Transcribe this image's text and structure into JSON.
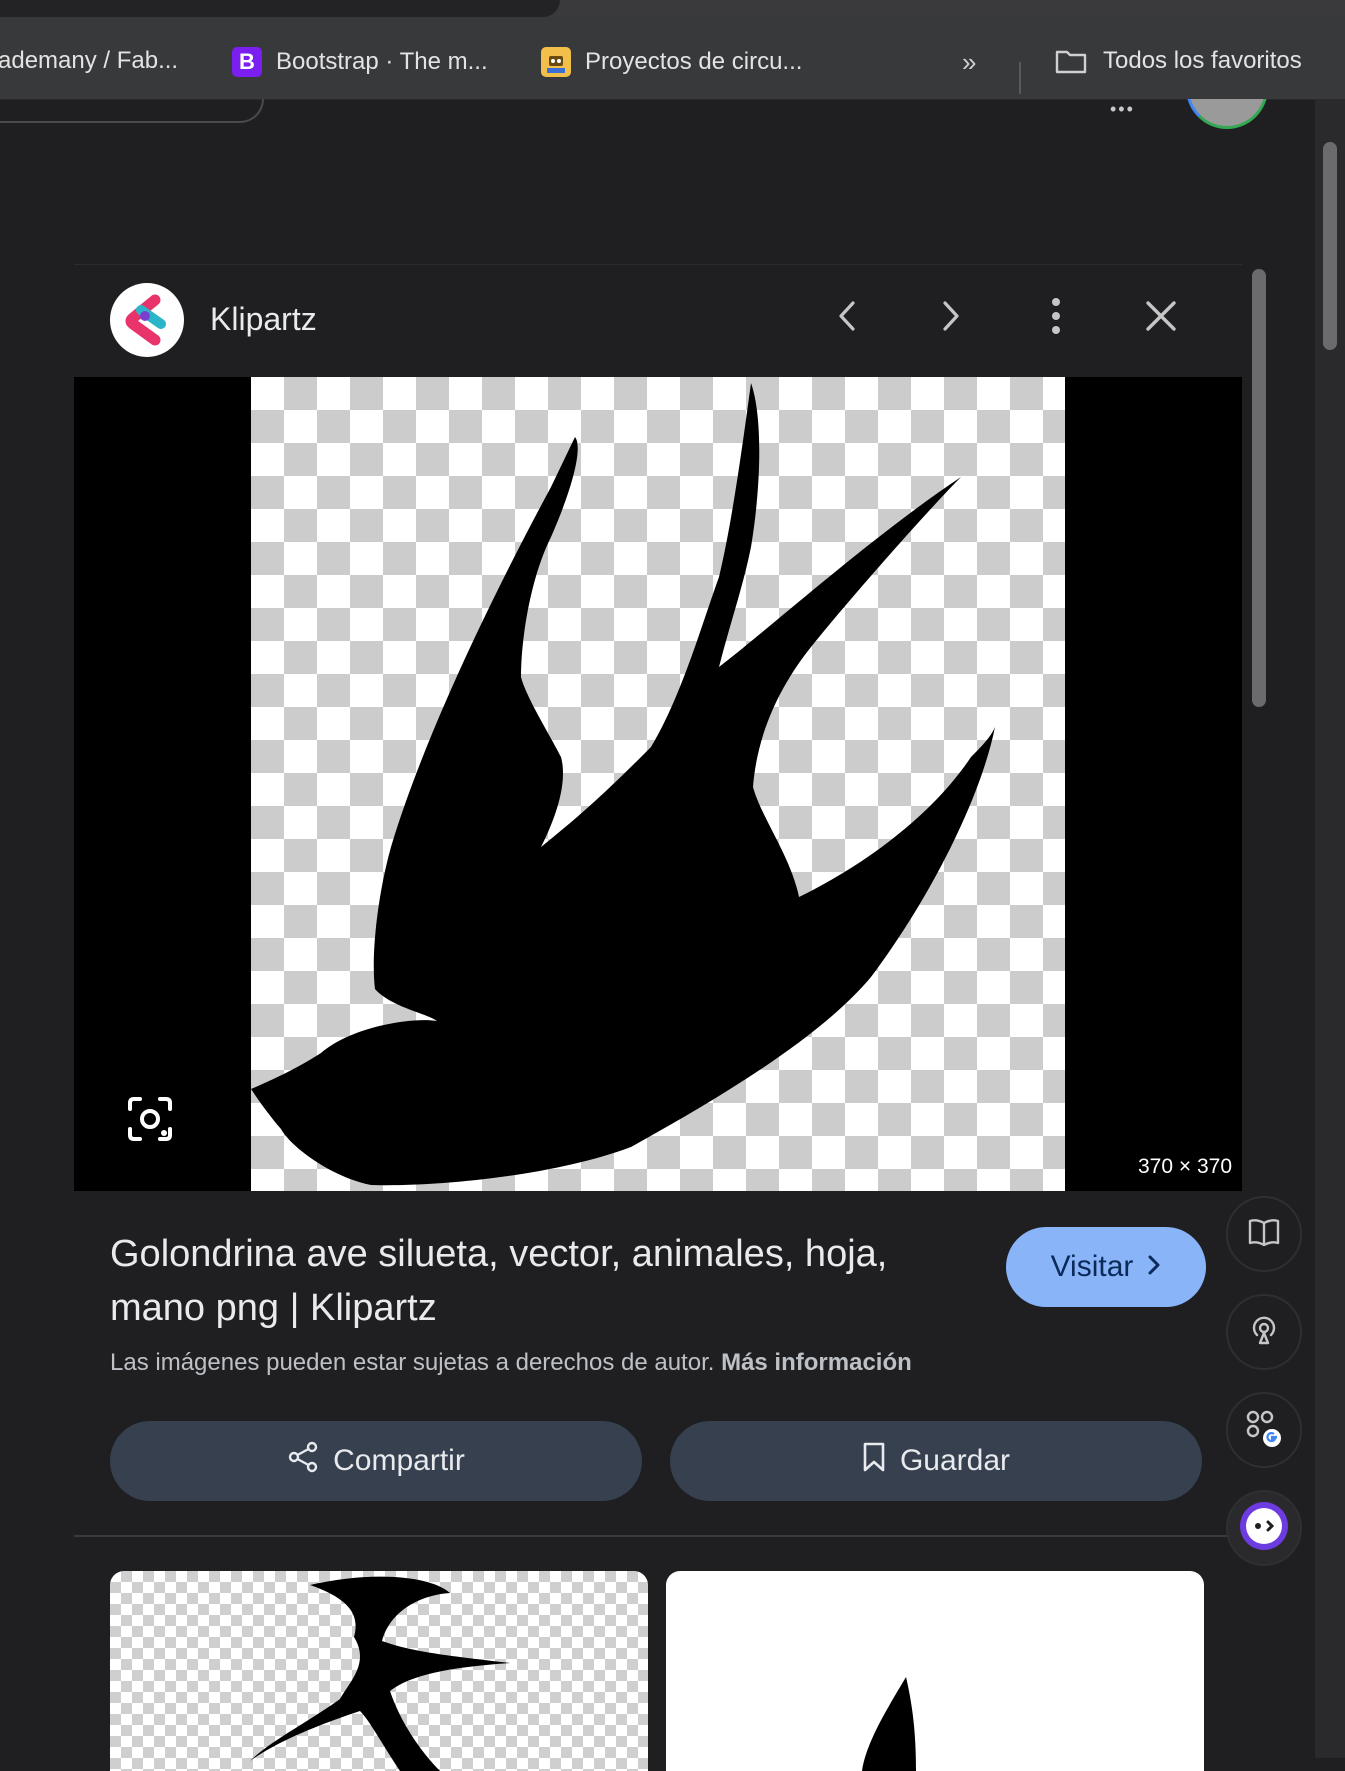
{
  "bookmarks": {
    "items": [
      {
        "label": "ademany / Fab..."
      },
      {
        "label": "Bootstrap · The m...",
        "icon_text": "B"
      },
      {
        "label": "Proyectos de circu..."
      }
    ],
    "overflow_label": "»",
    "all_favorites_label": "Todos los favoritos"
  },
  "header": {
    "apps_label": "•••"
  },
  "panel": {
    "site_name": "Klipartz",
    "image_dimensions": "370 × 370",
    "title": "Golondrina ave silueta, vector, animales, hoja, mano png | Klipartz",
    "visit_label": "Visitar",
    "copyright_text": "Las imágenes pueden estar sujetas a derechos de autor.",
    "more_info_label": "Más información",
    "share_label": "Compartir",
    "save_label": "Guardar"
  },
  "colors": {
    "accent_button": "#8ab4f8",
    "action_button": "#37404f",
    "background": "#1f1f22",
    "logo_pink": "#e8336b",
    "logo_teal": "#2bb5c8"
  },
  "icons": [
    "chevron-left-icon",
    "chevron-right-icon",
    "more-vert-icon",
    "close-icon",
    "lens-icon",
    "share-icon",
    "bookmark-icon",
    "folder-icon",
    "book-icon",
    "podcast-icon",
    "google-apps-icon",
    "assistant-icon"
  ]
}
